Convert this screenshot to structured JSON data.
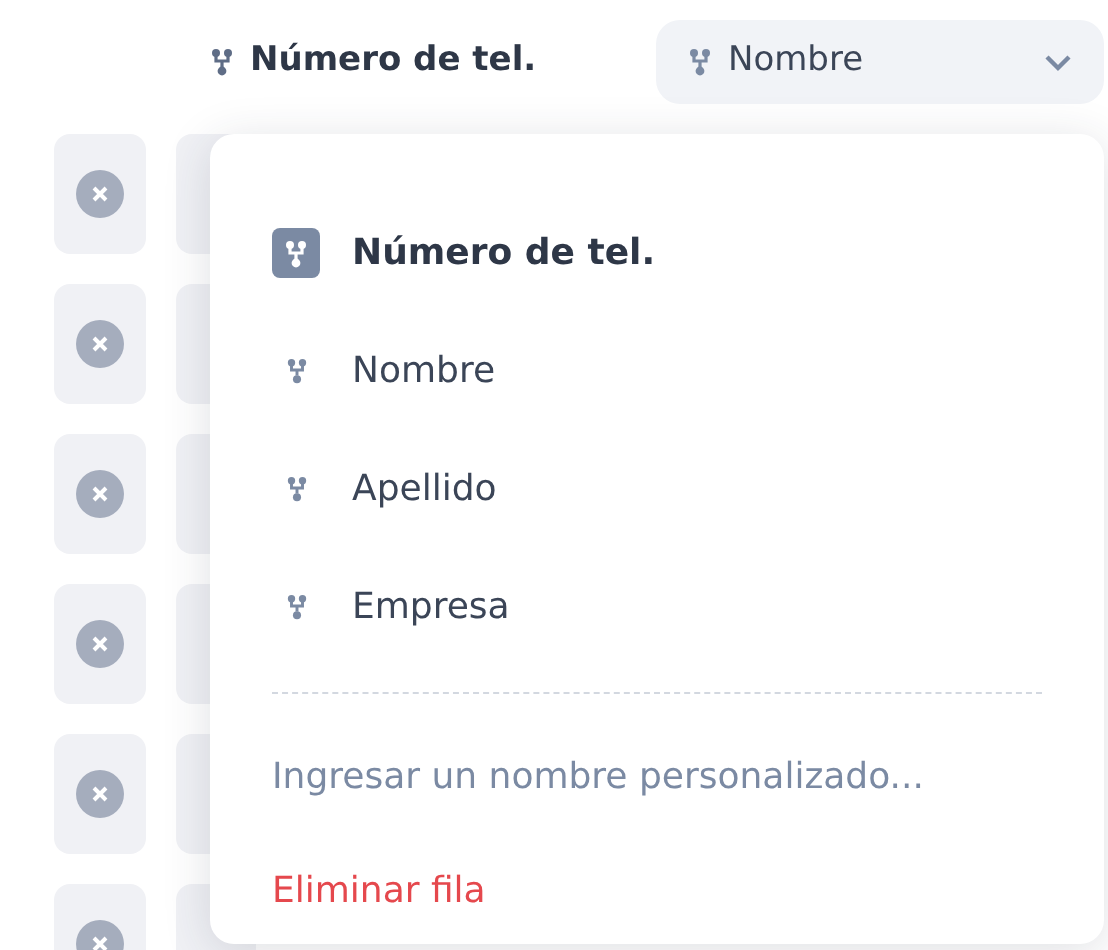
{
  "header": {
    "label": "Número de tel.",
    "dropdown": {
      "value": "Nombre"
    }
  },
  "menu": {
    "options": [
      {
        "label": "Número de tel.",
        "selected": true
      },
      {
        "label": "Nombre",
        "selected": false
      },
      {
        "label": "Apellido",
        "selected": false
      },
      {
        "label": "Empresa",
        "selected": false
      }
    ],
    "actions": [
      {
        "kind": "custom",
        "label": "Ingresar un nombre personalizado..."
      },
      {
        "kind": "delete",
        "label": "Eliminar fila"
      }
    ]
  }
}
